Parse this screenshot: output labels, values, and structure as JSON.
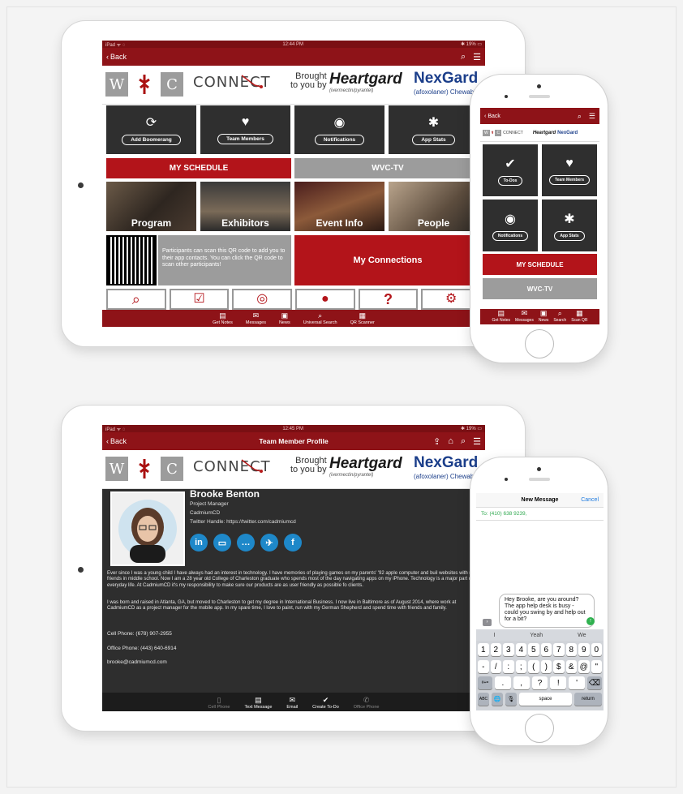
{
  "top_ipad": {
    "status": {
      "carrier": "iPad ᯤ ◌",
      "time": "12:44 PM",
      "battery": "✱ 19% ▭"
    },
    "nav": {
      "back": "Back"
    },
    "banner": {
      "w": "W",
      "c": "C",
      "connect": "CONNECT",
      "brought": "Brought",
      "to_you_by": "to you by",
      "heartgard": "Heartgard",
      "heartgard_sub": "(ivermectin/pyrantel)",
      "plus": "Plus",
      "nexgard": "NexGard",
      "nexgard_sub": "(afoxolaner) Chewables"
    },
    "tiles": [
      {
        "label": "Add Boomerang",
        "icon": "⟳"
      },
      {
        "label": "Team Members",
        "icon": "♥"
      },
      {
        "label": "Notifications",
        "icon": "◉"
      },
      {
        "label": "App Stats",
        "icon": "✱"
      }
    ],
    "my_schedule": "MY SCHEDULE",
    "wvc_tv": "WVC-TV",
    "photos": [
      "Program",
      "Exhibitors",
      "Event Info",
      "People"
    ],
    "qr_text": "Participants can scan this QR code to add you to their app contacts.  You can click the QR code to scan other participants!",
    "my_connections": "My Connections",
    "tabbar": [
      "Get Notes",
      "Messages",
      "News",
      "Universal Search",
      "QR Scanner"
    ]
  },
  "top_iphone": {
    "nav": {
      "back": "Back"
    },
    "tiles": [
      {
        "label": "To-Dos",
        "icon": "✔"
      },
      {
        "label": "Team Members",
        "icon": "♥"
      },
      {
        "label": "Notifications",
        "icon": "◉"
      },
      {
        "label": "App Stats",
        "icon": "✱"
      }
    ],
    "my_schedule": "MY SCHEDULE",
    "wvc_tv": "WVC-TV",
    "tabbar": [
      "Get Notes",
      "Messages",
      "News",
      "Search",
      "Scan QR"
    ]
  },
  "bottom_ipad": {
    "status": {
      "carrier": "iPad ᯤ ◌",
      "time": "12:45 PM",
      "battery": "✱ 19% ▭"
    },
    "nav": {
      "back": "Back",
      "title": "Team Member Profile"
    },
    "profile": {
      "name": "Brooke Benton",
      "title": "Project Manager",
      "company": "CadmiumCD",
      "twitter": "Twitter Handle: https://twitter.com/cadmiumcd",
      "bio1": "Ever since I was a young child I have always had an interest in technology. I have memories of playing games on my parents' '92 apple computer and buil websites with my friends in middle school. Now I am a 28 year old College of Charleston graduate who spends most of the day navigating apps on my iPhone. Technology is a major part of my everyday life. At CadmiumCD it's my responsibility to make sure our products are as user friendly as possible fo clients.",
      "bio2": "I was born and raised in Atlanta, GA, but moved to Charleston to get my degree in International Business. I now live in Baltimore as of August 2014, where work at CadmiumCD as a project manager for the mobile app. In my spare time, I love to paint, run with my German Shepherd and spend time with friends and family.",
      "cell": "Cell Phone: (678) 907-2955",
      "office": "Office Phone: (443) 640-6914",
      "email": "brooke@cadmiumcd.com"
    },
    "tabbar": [
      "Cell Phone",
      "Text Message",
      "Email",
      "Create To-Do",
      "Office Phone"
    ]
  },
  "bottom_iphone": {
    "header": {
      "title": "New Message",
      "cancel": "Cancel"
    },
    "to": "To: (410) 638 9239,",
    "message": "Hey Brooke, are you around? The app help desk is busy - could you swing by and help out for a bit?",
    "suggestions": [
      "I",
      "Yeah",
      "We"
    ],
    "row1": [
      "1",
      "2",
      "3",
      "4",
      "5",
      "6",
      "7",
      "8",
      "9",
      "0"
    ],
    "row2": [
      "-",
      "/",
      ":",
      ";",
      "(",
      ")",
      "$",
      "&",
      "@",
      "\""
    ],
    "row3": [
      "#+=",
      ".",
      ",",
      "?",
      "!",
      "'",
      "⌫"
    ],
    "row4": [
      "ABC",
      "🌐",
      "🎙",
      "space",
      "return"
    ]
  },
  "colors": {
    "brand_red": "#8e1318",
    "tile_dark": "#2f2f2f",
    "gray_bar": "#9c9c9c",
    "link_blue": "#1e88c9"
  }
}
